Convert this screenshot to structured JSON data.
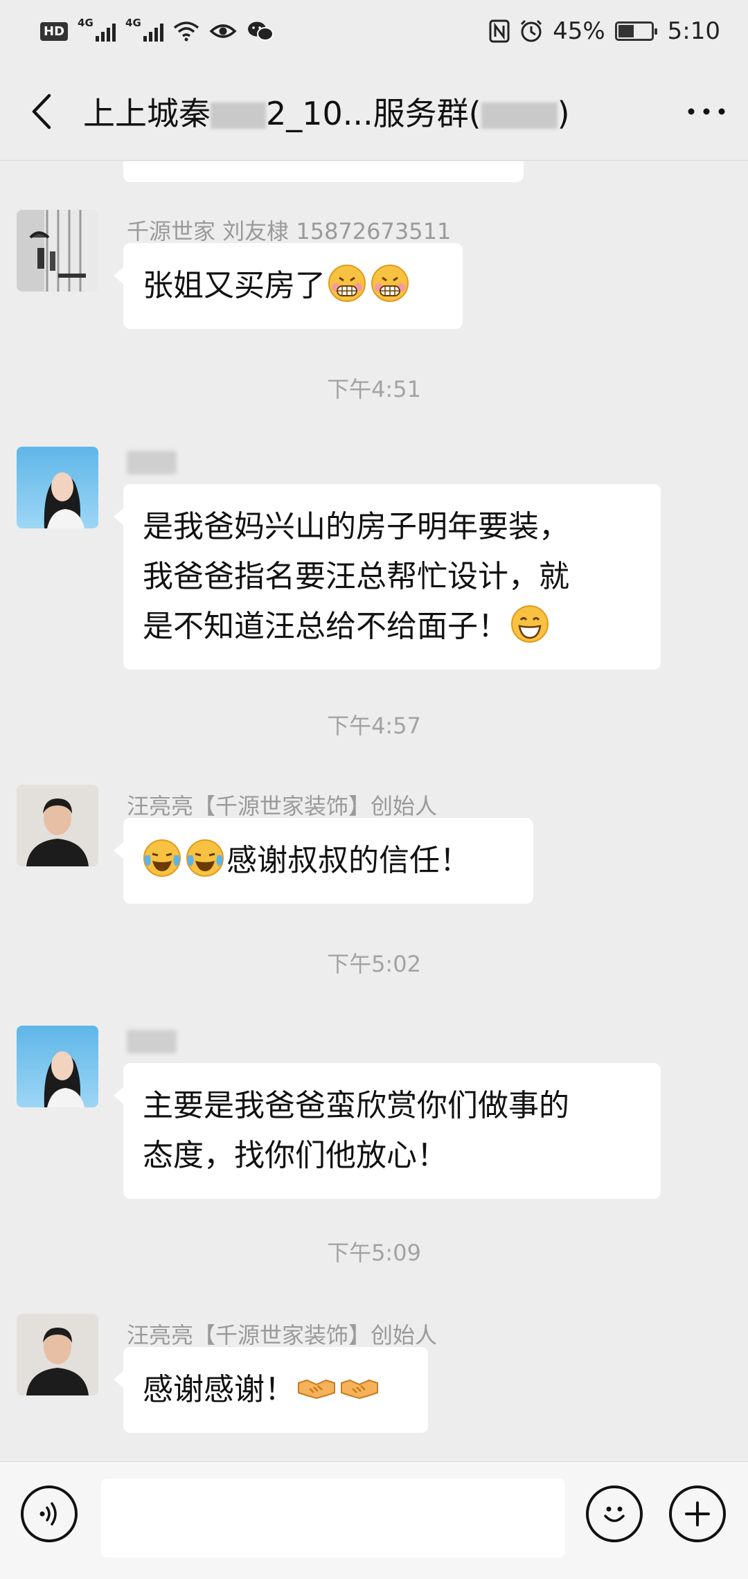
{
  "status_bar": {
    "hd": "HD",
    "net1": "4G",
    "net2": "4G",
    "battery_percent": "45%",
    "battery_level": 0.45,
    "time": "5:10"
  },
  "header": {
    "title_prefix": "上上城秦",
    "title_mid": "2_10...服务群(",
    "title_suffix": ")"
  },
  "messages": [
    {
      "sender": "千源世家   刘友棣 15872673511",
      "text": "张姐又买房了",
      "emojis": [
        "grimace-emoji",
        "grimace-emoji"
      ]
    },
    {
      "time": "下午4:51"
    },
    {
      "sender": "",
      "text_lines": [
        "是我爸妈兴山的房子明年要装，",
        "我爸爸指名要汪总帮忙设计，就",
        "是不知道汪总给不给面子！"
      ],
      "emojis": [
        "grin-emoji"
      ]
    },
    {
      "time": "下午4:57"
    },
    {
      "sender": "汪亮亮【千源世家装饰】创始人",
      "text": "感谢叔叔的信任！",
      "emojis": [
        "crying-laughing-emoji",
        "crying-laughing-emoji"
      ]
    },
    {
      "time": "下午5:02"
    },
    {
      "sender": "",
      "text_lines": [
        "主要是我爸爸蛮欣赏你们做事的",
        "态度，找你们他放心！"
      ]
    },
    {
      "time": "下午5:09"
    },
    {
      "sender": "汪亮亮【千源世家装饰】创始人",
      "text": "感谢感谢！",
      "emojis": [
        "handshake-emoji",
        "handshake-emoji"
      ]
    }
  ],
  "input": {
    "value": "",
    "placeholder": ""
  },
  "colors": {
    "background": "#ededed",
    "bubble": "#ffffff",
    "timestamp": "#a3a3a3",
    "sender": "#9a9a9a"
  }
}
